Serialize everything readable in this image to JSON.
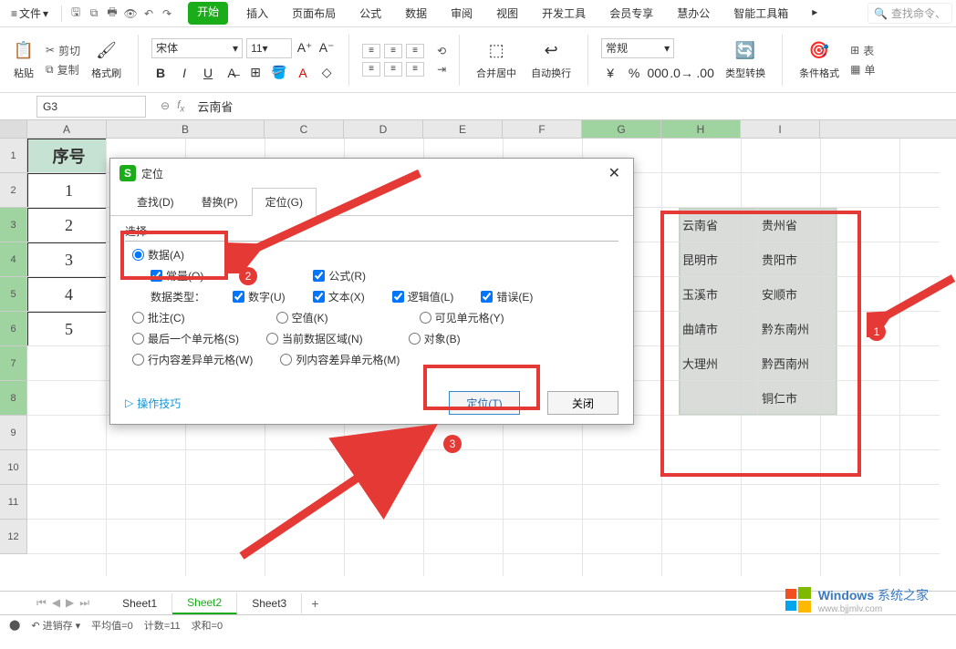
{
  "menubar": {
    "file_label": "文件",
    "tabs": [
      "开始",
      "插入",
      "页面布局",
      "公式",
      "数据",
      "审阅",
      "视图",
      "开发工具",
      "会员专享",
      "慧办公",
      "智能工具箱"
    ],
    "active_tab_index": 0,
    "search_placeholder": "查找命令、"
  },
  "ribbon": {
    "paste_label": "粘贴",
    "cut_label": "剪切",
    "copy_label": "复制",
    "format_painter_label": "格式刷",
    "font_name": "宋体",
    "font_size": "11",
    "merge_label": "合并居中",
    "wrap_label": "自动换行",
    "general_label": "常规",
    "type_convert_label": "类型转换",
    "cond_format_label": "条件格式",
    "table_style_label": "表",
    "sum_label": "单"
  },
  "name_box": "G3",
  "formula_value": "云南省",
  "columns": [
    "A",
    "B",
    "C",
    "D",
    "E",
    "F",
    "G",
    "H",
    "I"
  ],
  "selected_columns": [
    "G",
    "H"
  ],
  "row_count": 12,
  "selected_rows": [
    3,
    4,
    5,
    6,
    7,
    8
  ],
  "a_column": {
    "header": "序号",
    "values": [
      "1",
      "2",
      "3",
      "4",
      "5"
    ]
  },
  "gh_data": [
    {
      "g": "云南省",
      "h": "贵州省"
    },
    {
      "g": "昆明市",
      "h": "贵阳市"
    },
    {
      "g": "玉溪市",
      "h": "安顺市"
    },
    {
      "g": "曲靖市",
      "h": "黔东南州"
    },
    {
      "g": "大理州",
      "h": "黔西南州"
    },
    {
      "g": "",
      "h": "铜仁市"
    }
  ],
  "dialog": {
    "title": "定位",
    "tabs": {
      "find": "查找(D)",
      "replace": "替换(P)",
      "goto": "定位(G)"
    },
    "section_label": "选择",
    "opts": {
      "data": "数据(A)",
      "constant": "常量(O)",
      "formula": "公式(R)",
      "data_type": "数据类型：",
      "number": "数字(U)",
      "text": "文本(X)",
      "logical": "逻辑值(L)",
      "error": "错误(E)",
      "comment": "批注(C)",
      "blank": "空值(K)",
      "visible": "可见单元格(Y)",
      "lastcell": "最后一个单元格(S)",
      "currentregion": "当前数据区域(N)",
      "object": "对象(B)",
      "rowdiff": "行内容差异单元格(W)",
      "coldiff": "列内容差异单元格(M)"
    },
    "tips_label": "操作技巧",
    "locate_btn": "定位(T)",
    "close_btn": "关闭"
  },
  "annotations": {
    "b1": "1",
    "b2": "2",
    "b3": "3"
  },
  "sheets": {
    "s1": "Sheet1",
    "s2": "Sheet2",
    "s3": "Sheet3"
  },
  "status": {
    "undo_label": "进销存",
    "avg": "平均值=0",
    "count": "计数=11",
    "sum": "求和=0"
  },
  "watermark": {
    "line1a": "Windows",
    "line1b": "系统之家",
    "line2": "www.bjjmlv.com"
  }
}
